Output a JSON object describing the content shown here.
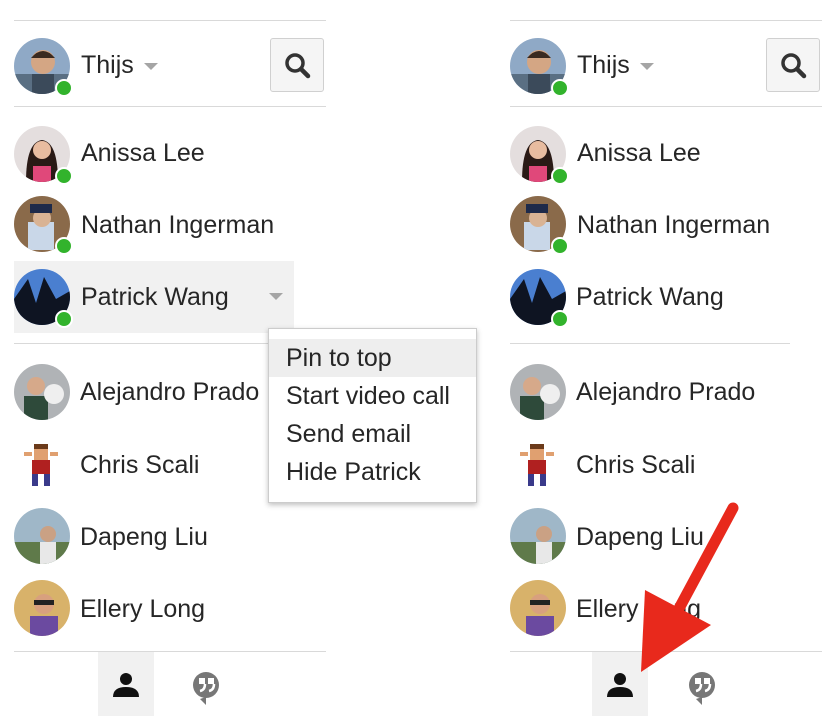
{
  "colors": {
    "presence": "#32b32c",
    "arrow": "#e8291c",
    "hover": "#f1f1f1",
    "text": "#262626"
  },
  "left_panel": {
    "me": {
      "name": "Thijs",
      "status": "online"
    },
    "search_icon": "search-icon",
    "contacts": [
      {
        "name": "Anissa Lee",
        "online": true
      },
      {
        "name": "Nathan Ingerman",
        "online": true
      },
      {
        "name": "Patrick Wang",
        "online": true,
        "hovered": true
      }
    ],
    "others": [
      {
        "name": "Alejandro Prado"
      },
      {
        "name": "Chris Scali"
      },
      {
        "name": "Dapeng Liu"
      },
      {
        "name": "Ellery Long"
      }
    ],
    "context_menu": {
      "items": [
        "Pin to top",
        "Start video call",
        "Send email",
        "Hide Patrick"
      ],
      "active_index": 0
    },
    "tabs": [
      {
        "icon": "person-icon",
        "selected": true
      },
      {
        "icon": "quote-icon",
        "selected": false
      }
    ]
  },
  "right_panel": {
    "me": {
      "name": "Thijs",
      "status": "online"
    },
    "contacts": [
      {
        "name": "Anissa Lee",
        "online": true
      },
      {
        "name": "Nathan Ingerman",
        "online": true
      },
      {
        "name": "Patrick Wang",
        "online": true
      }
    ],
    "others": [
      {
        "name": "Alejandro Prado"
      },
      {
        "name": "Chris Scali"
      },
      {
        "name": "Dapeng Liu"
      },
      {
        "name": "Ellery Long"
      }
    ],
    "tabs": [
      {
        "icon": "person-icon",
        "selected": true
      },
      {
        "icon": "quote-icon",
        "selected": false
      }
    ]
  },
  "annotation": {
    "icon": "red-arrow-icon"
  }
}
